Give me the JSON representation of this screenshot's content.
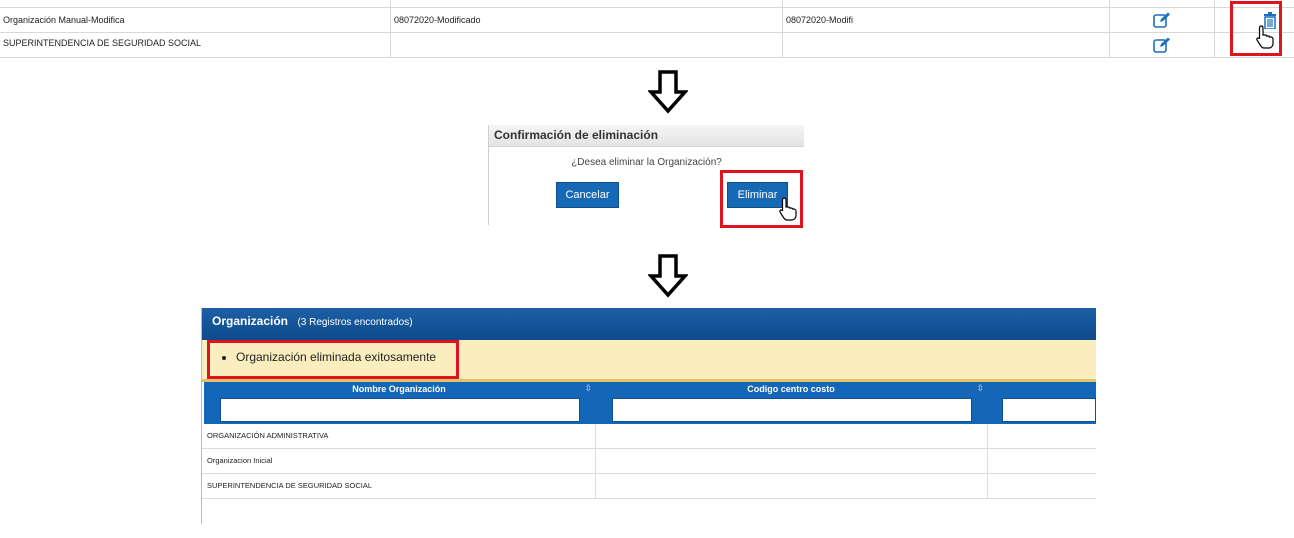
{
  "top_table": {
    "rows": [
      {
        "name": "Organización Manual-Modifica",
        "code": "08072020-Modificado",
        "code2": "08072020-Modifi"
      },
      {
        "name": "SUPERINTENDENCIA DE SEGURIDAD SOCIAL",
        "code": "",
        "code2": ""
      }
    ]
  },
  "dialog": {
    "title": "Confirmación de eliminación",
    "question": "¿Desea eliminar la Organización?",
    "cancel_label": "Cancelar",
    "delete_label": "Eliminar"
  },
  "result": {
    "title": "Organización",
    "count": "(3 Registros encontrados)",
    "message": "Organización eliminada exitosamente",
    "columns": [
      "Nombre Organización",
      "Codigo centro costo"
    ],
    "rows": [
      "ORGANIZACIÓN ADMINISTRATIVA",
      "Organizacion Inicial",
      "SUPERINTENDENCIA DE SEGURIDAD SOCIAL"
    ]
  },
  "colors": {
    "accent": "#1569b5",
    "highlight": "#e0141e",
    "message_bg": "#faeebf"
  },
  "icons": [
    "edit-icon",
    "trash-icon",
    "down-arrow-icon",
    "hand-cursor-icon",
    "sort-icon"
  ]
}
